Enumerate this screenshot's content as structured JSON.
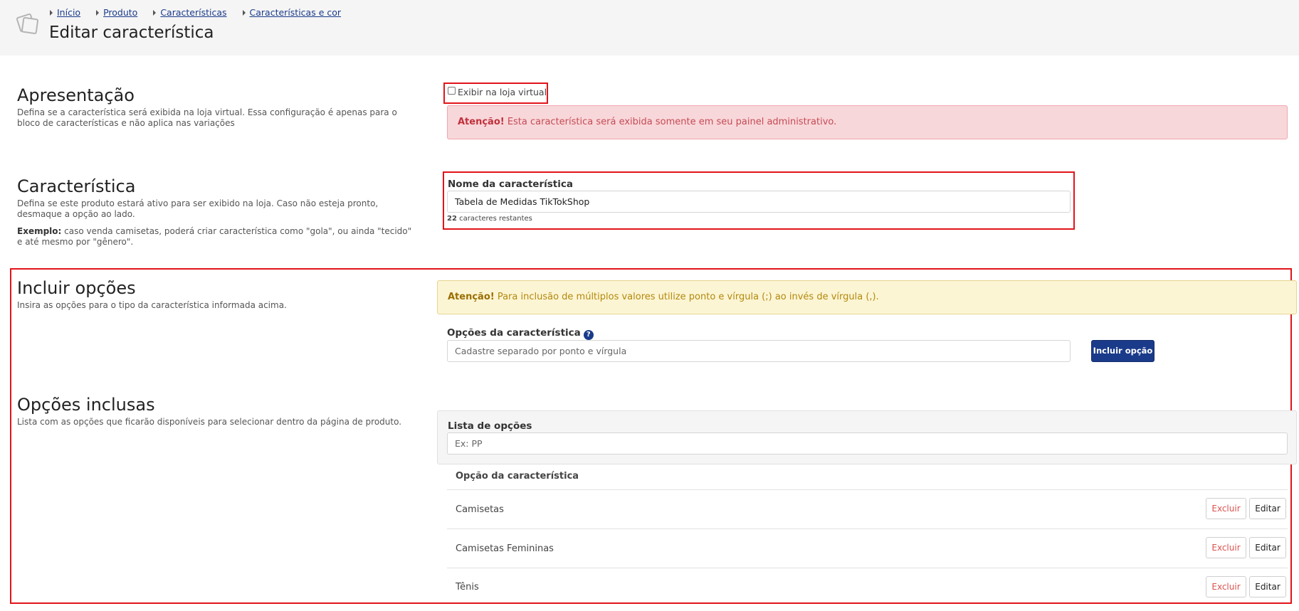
{
  "breadcrumb": [
    "Início",
    "Produto",
    "Características",
    "Características e cor"
  ],
  "page_title": "Editar característica",
  "apresentacao": {
    "title": "Apresentação",
    "desc": "Defina se a característica será exibida na loja virtual. Essa configuração é apenas para o bloco de características e não aplica nas variações",
    "checkbox_label": "Exibir na loja virtual",
    "alert_strong": "Atenção!",
    "alert_text": " Esta característica será exibida somente em seu painel administrativo."
  },
  "caracteristica": {
    "title": "Característica",
    "desc": "Defina se este produto estará ativo para ser exibido na loja. Caso não esteja pronto, desmaque a opção ao lado.",
    "example_strong": "Exemplo:",
    "example_text": " caso venda camisetas, poderá criar característica como \"gola\", ou ainda \"tecido\" e até mesmo por \"gênero\".",
    "field_label": "Nome da característica",
    "field_value": "Tabela de Medidas TikTokShop",
    "remaining_count": "22",
    "remaining_text": " caracteres restantes"
  },
  "incluir": {
    "title": "Incluir opções",
    "desc": "Insira as opções para o tipo da característica informada acima.",
    "alert_strong": "Atenção!",
    "alert_text": " Para inclusão de múltiplos valores utilize ponto e vírgula (;) ao invés de vírgula (,).",
    "field_label": "Opções da característica",
    "help_glyph": "?",
    "field_placeholder": "Cadastre separado por ponto e vírgula",
    "button_label": "Incluir opção"
  },
  "inclusas": {
    "title": "Opções inclusas",
    "desc": "Lista com as opções que ficarão disponíveis para selecionar dentro da página de produto.",
    "list_label": "Lista de opções",
    "filter_placeholder": "Ex: PP",
    "column_header": "Opção da característica",
    "delete_label": "Excluir",
    "edit_label": "Editar",
    "rows": [
      "Camisetas",
      "Camisetas Femininas",
      "Tênis"
    ]
  }
}
